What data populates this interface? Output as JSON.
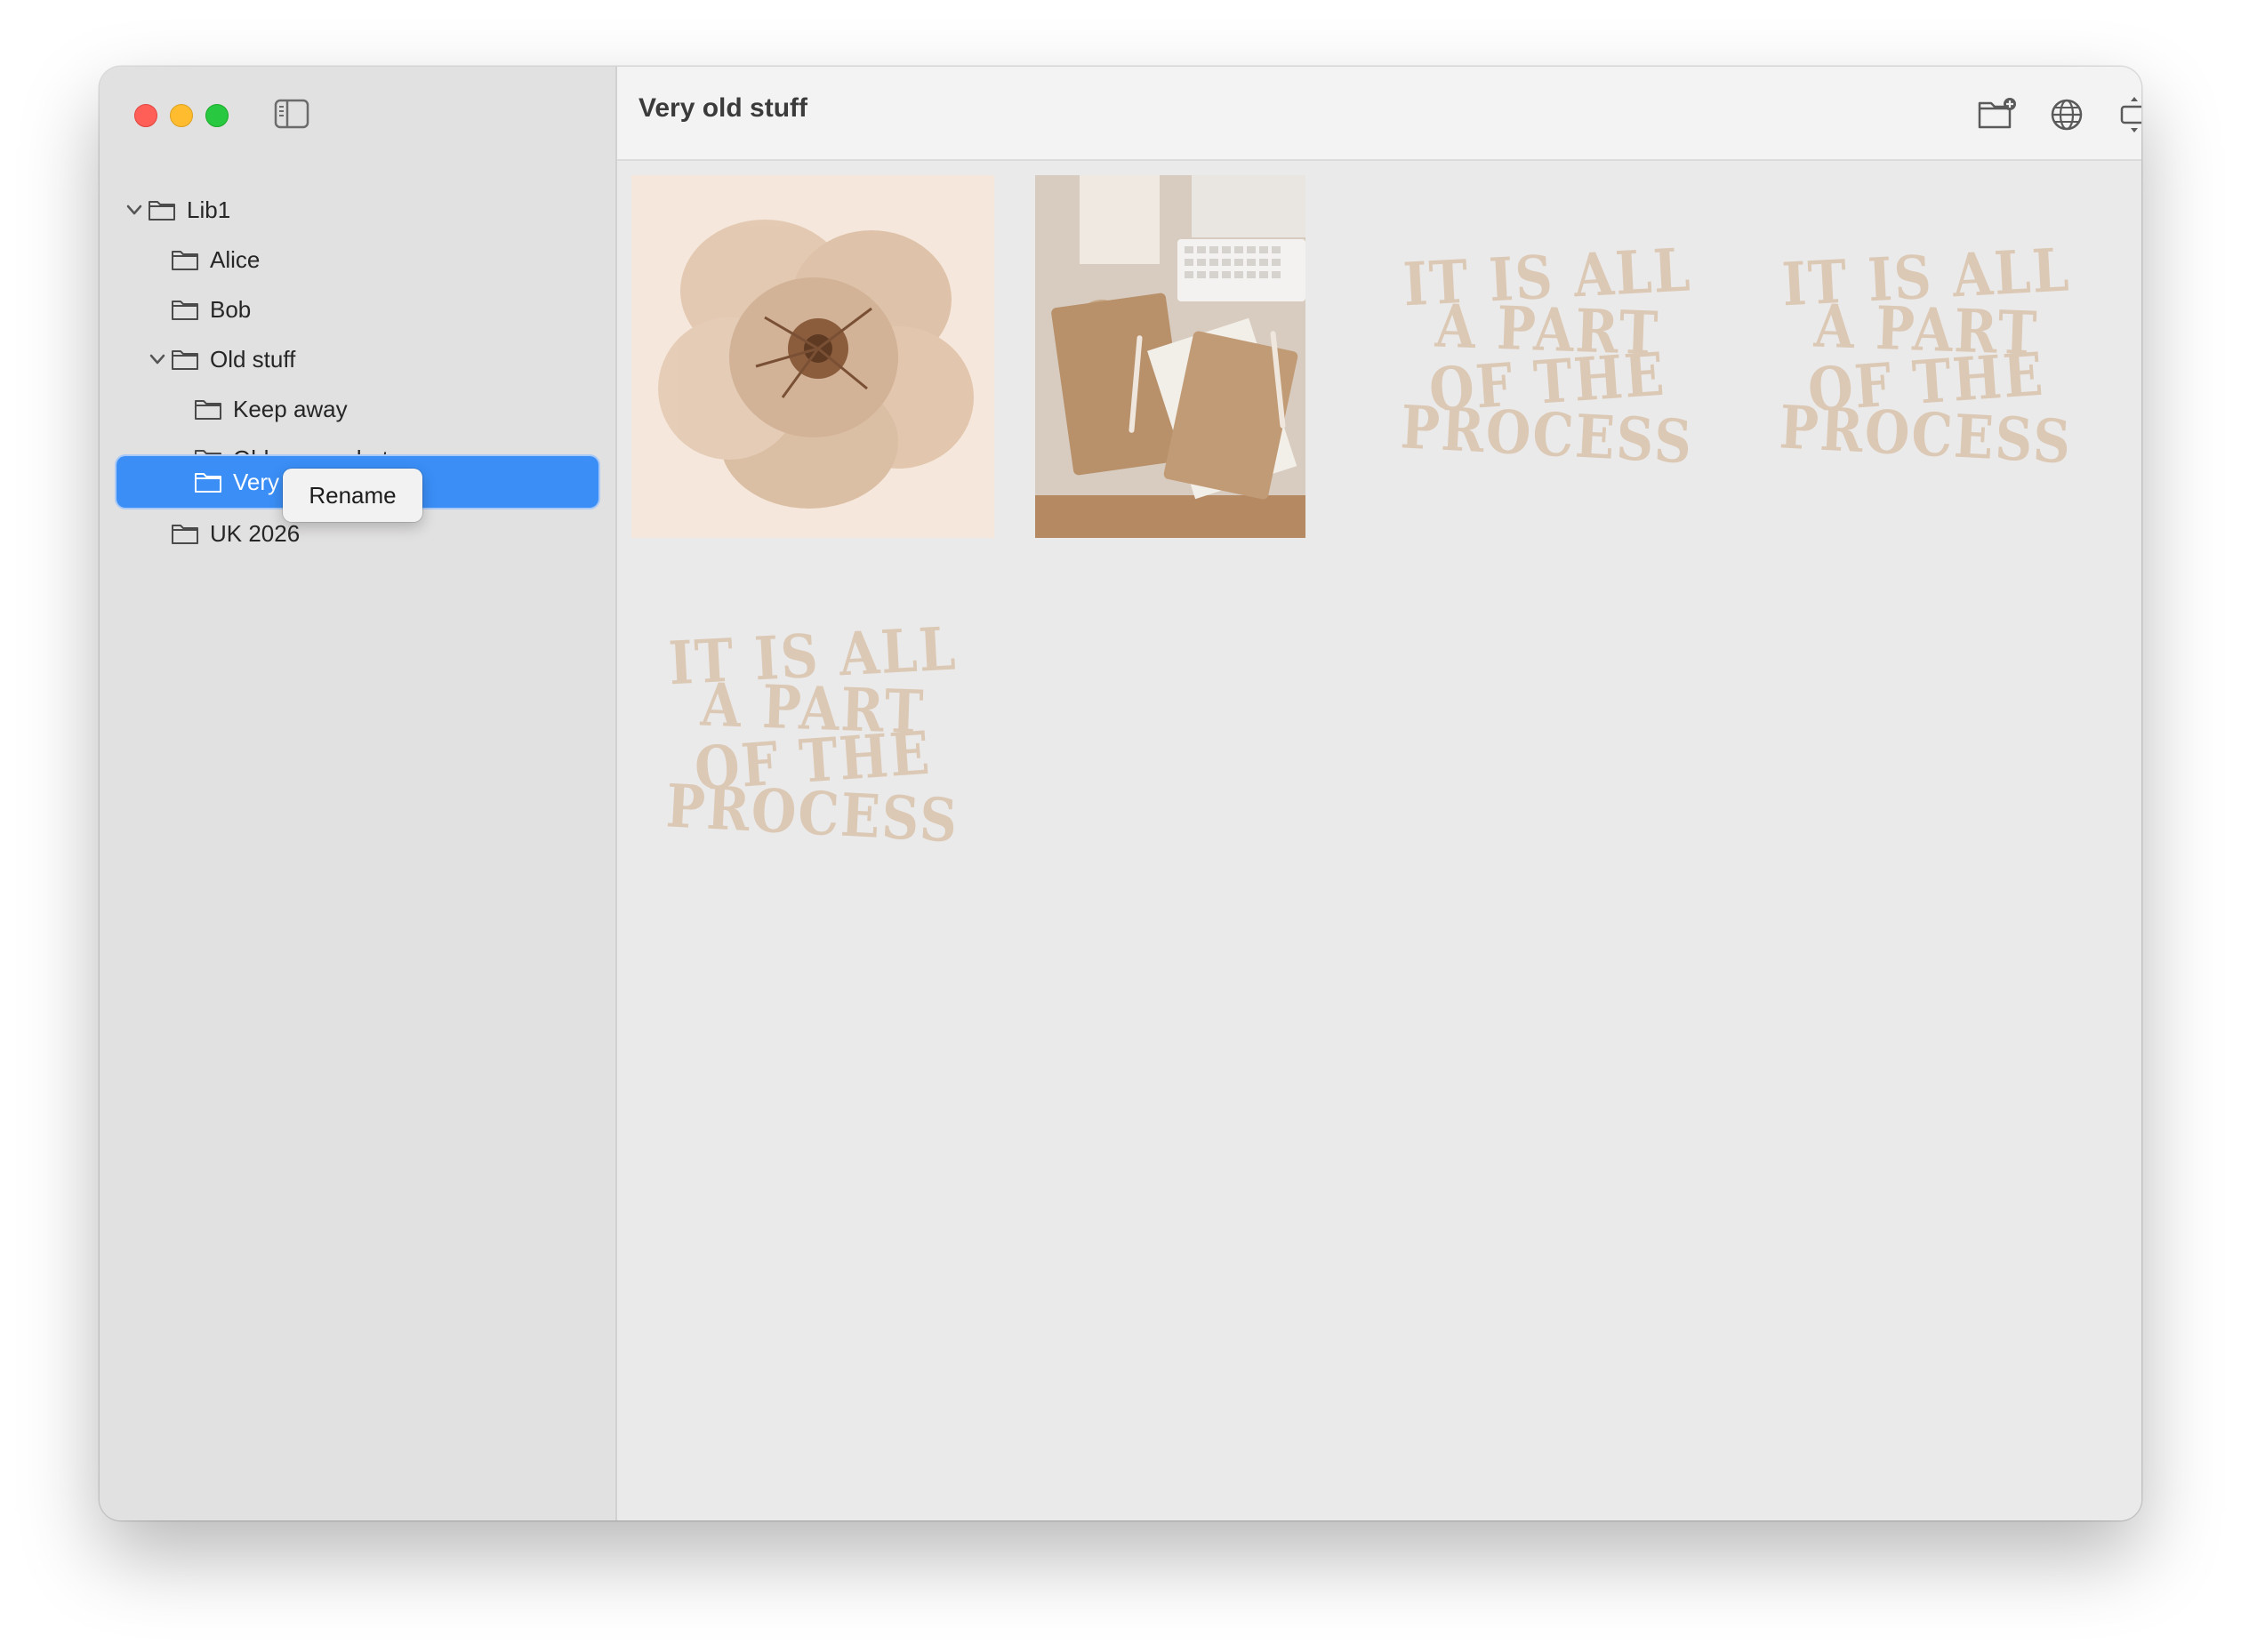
{
  "window": {
    "controls": [
      "close",
      "minimize",
      "zoom"
    ],
    "sidebar_toggle_icon": "sidebar-left-icon"
  },
  "sidebar": {
    "tree": [
      {
        "id": "lib1",
        "label": "Lib1",
        "expanded": true,
        "icon": "folder-icon"
      },
      {
        "id": "alice",
        "label": "Alice",
        "icon": "folder-icon"
      },
      {
        "id": "bob",
        "label": "Bob",
        "icon": "folder-icon"
      },
      {
        "id": "old-stuff",
        "label": "Old stuff",
        "expanded": true,
        "icon": "folder-icon"
      },
      {
        "id": "keep-away",
        "label": "Keep away",
        "icon": "folder-icon"
      },
      {
        "id": "old-screenshots",
        "label": "Old screenshots",
        "icon": "folder-icon"
      },
      {
        "id": "very-old-stuff",
        "label": "Very",
        "selected": true,
        "editing": true,
        "icon": "folder-icon"
      },
      {
        "id": "uk-2026",
        "label": "UK 2026",
        "icon": "folder-icon"
      }
    ],
    "popup": {
      "label": "Rename"
    },
    "colors": {
      "selection": "#3a8ef6"
    }
  },
  "main": {
    "title": "Very old stuff",
    "toolbar_icons": [
      "new-folder-icon",
      "globe-icon",
      "resize-icon",
      "play-icon"
    ],
    "thumbnails": [
      {
        "name": "flower-watercolor",
        "kind": "image"
      },
      {
        "name": "desk-notebooks",
        "kind": "image"
      },
      {
        "name": "quote-1",
        "kind": "text-art",
        "lines": [
          "IT IS ALL",
          "A PART",
          "OF THE",
          "PROCESS"
        ]
      },
      {
        "name": "quote-2",
        "kind": "text-art",
        "lines": [
          "IT IS ALL",
          "A PART",
          "OF THE",
          "PROCESS"
        ]
      },
      {
        "name": "quote-3",
        "kind": "text-art",
        "lines": [
          "IT IS ALL",
          "A PART",
          "OF THE",
          "PROCESS"
        ]
      }
    ]
  }
}
